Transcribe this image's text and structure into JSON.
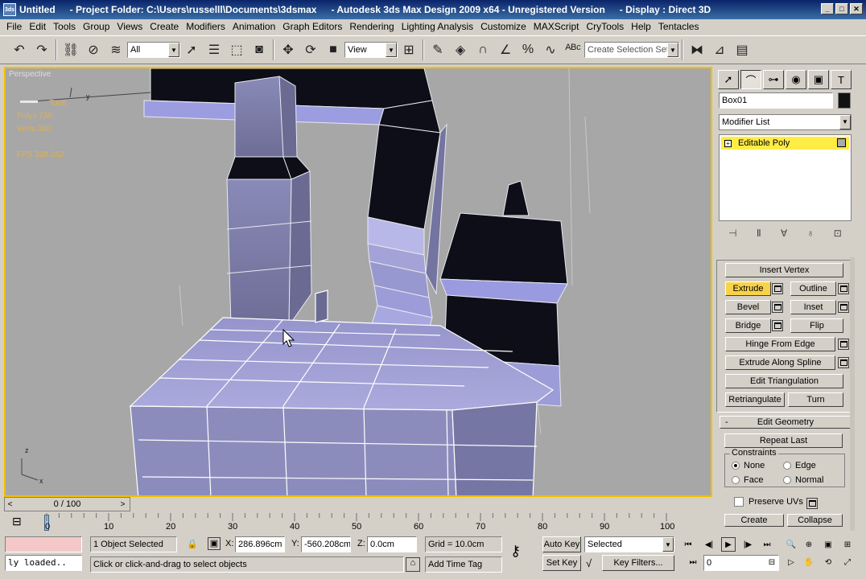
{
  "window": {
    "title_untitled": "Untitled",
    "project_folder": "- Project Folder: C:\\Users\\russelll\\Documents\\3dsmax",
    "app_name": "- Autodesk 3ds Max Design 2009 x64 - Unregistered Version",
    "display": "- Display : Direct 3D",
    "app_icon_text": "3ds"
  },
  "menu": [
    "File",
    "Edit",
    "Tools",
    "Group",
    "Views",
    "Create",
    "Modifiers",
    "Animation",
    "Graph Editors",
    "Rendering",
    "Lighting Analysis",
    "Customize",
    "MAXScript",
    "CryTools",
    "Help",
    "Tentacles"
  ],
  "toolbar": {
    "filter_value": "All",
    "ref_coord_value": "View",
    "selection_set_placeholder": "Create Selection Set"
  },
  "viewport": {
    "label": "Perspective",
    "stats": [
      "Total",
      "Polys 730",
      "Verts 320",
      "FPS 328.162"
    ],
    "axis_labels": [
      "z",
      "y",
      "x"
    ]
  },
  "command_panel": {
    "tab_icons": [
      "cursor-icon",
      "curve-icon",
      "hierarchy-icon",
      "motion-icon",
      "display-icon",
      "utilities-icon"
    ],
    "object_name": "Box01",
    "modifier_list": "Modifier List",
    "stack_item": "Editable Poly",
    "stack_buttons": [
      "pin-stack-icon",
      "show-end-result-icon",
      "make-unique-icon",
      "remove-modifier-icon",
      "configure-modifier-sets-icon"
    ],
    "edit_vertices": {
      "insert_vertex": "Insert Vertex",
      "extrude": "Extrude",
      "outline": "Outline",
      "bevel": "Bevel",
      "inset": "Inset",
      "bridge": "Bridge",
      "flip": "Flip",
      "hinge_from_edge": "Hinge From Edge",
      "extrude_along_spline": "Extrude Along Spline",
      "edit_triangulation": "Edit Triangulation",
      "retriangulate": "Retriangulate",
      "turn": "Turn"
    },
    "edit_geometry": {
      "header_sign": "-",
      "header": "Edit Geometry",
      "repeat_last": "Repeat Last",
      "constraints_label": "Constraints",
      "constraints": [
        "None",
        "Edge",
        "Face",
        "Normal"
      ],
      "constraint_selected": "None",
      "preserve_uvs": "Preserve UVs",
      "create": "Create",
      "collapse": "Collapse"
    }
  },
  "timeline": {
    "slider_text": "0 / 100",
    "slider_prev": "<",
    "slider_next": ">",
    "ticks": [
      "0",
      "10",
      "20",
      "30",
      "40",
      "50",
      "60",
      "70",
      "80",
      "90",
      "100"
    ]
  },
  "status": {
    "maxscript_listener": "ly loaded..",
    "selection": "1 Object Selected",
    "prompt": "Click or click-and-drag to select objects",
    "x_label": "X:",
    "x_value": "286.896cm",
    "y_label": "Y:",
    "y_value": "-560.208cm",
    "z_label": "Z:",
    "z_value": "0.0cm",
    "grid": "Grid = 10.0cm",
    "add_time_tag": "Add Time Tag",
    "auto_key": "Auto Key",
    "set_key": "Set Key",
    "selected_value": "Selected",
    "key_filters": "Key Filters...",
    "frame_value": "0"
  },
  "colors": {
    "title_bar": "#0a246a",
    "viewport_border": "#f0c000",
    "poly_face": "#9a9ad0",
    "poly_dark": "#10101c",
    "active_button": "#f8d24a",
    "stack_highlight": "#ffec44"
  }
}
